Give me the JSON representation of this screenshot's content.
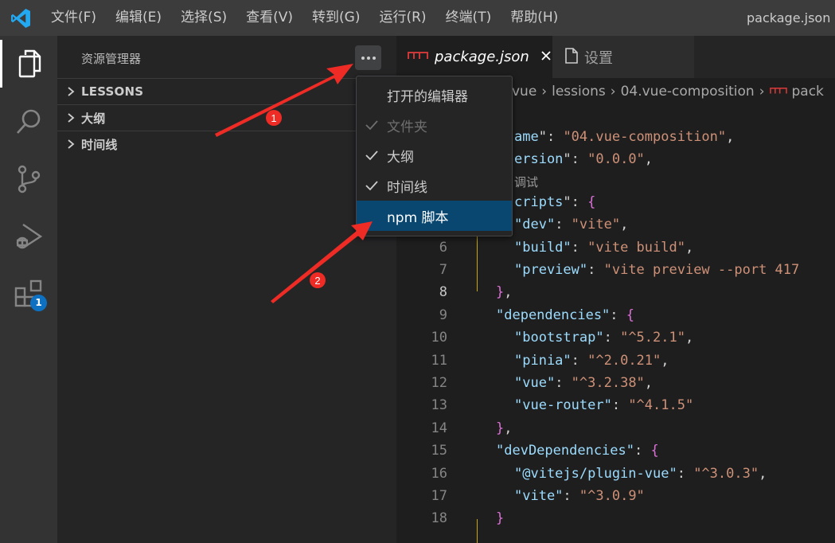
{
  "titlebar": {
    "menu": [
      "文件(F)",
      "编辑(E)",
      "选择(S)",
      "查看(V)",
      "转到(G)",
      "运行(R)",
      "终端(T)",
      "帮助(H)"
    ],
    "window_title": "package.json -"
  },
  "activitybar": {
    "items": [
      "explorer-icon",
      "search-icon",
      "source-control-icon",
      "run-debug-icon",
      "extensions-icon"
    ],
    "extensions_badge": "1"
  },
  "sidebar": {
    "title": "资源管理器",
    "sections": [
      "LESSONS",
      "大纲",
      "时间线"
    ]
  },
  "menu": {
    "items": [
      {
        "label": "打开的编辑器",
        "checked": false,
        "disabled": false,
        "highlighted": false
      },
      {
        "label": "文件夹",
        "checked": true,
        "disabled": true,
        "highlighted": false
      },
      {
        "label": "大纲",
        "checked": true,
        "disabled": false,
        "highlighted": false
      },
      {
        "label": "时间线",
        "checked": true,
        "disabled": false,
        "highlighted": false
      },
      {
        "label": "npm 脚本",
        "checked": false,
        "disabled": false,
        "highlighted": true
      }
    ]
  },
  "tabs": [
    {
      "label": "package.json",
      "icon": "npm-icon",
      "active": true
    },
    {
      "label": "设置",
      "icon": "file-icon",
      "active": false
    }
  ],
  "breadcrumb": [
    "vue",
    "lessions",
    "04.vue-composition",
    "pack"
  ],
  "editor": {
    "codelens": "调试",
    "line_numbers": [
      "6",
      "7",
      "8",
      "9",
      "10",
      "11",
      "12",
      "13",
      "14",
      "15",
      "16",
      "17",
      "18"
    ],
    "current_line": "8",
    "lines": [
      {
        "tokens": [
          {
            "t": "ame",
            "c": "k"
          },
          {
            "t": "\": ",
            "c": "p"
          },
          {
            "t": "\"04.vue-composition\"",
            "c": "s"
          },
          {
            "t": ",",
            "c": "p"
          }
        ]
      },
      {
        "tokens": [
          {
            "t": "ersion",
            "c": "k"
          },
          {
            "t": "\": ",
            "c": "p"
          },
          {
            "t": "\"0.0.0\"",
            "c": "s"
          },
          {
            "t": ",",
            "c": "p"
          }
        ]
      },
      {
        "tokens": [
          {
            "t": "cripts",
            "c": "k"
          },
          {
            "t": "\": ",
            "c": "p"
          },
          {
            "t": "{",
            "c": "b2"
          }
        ]
      },
      {
        "tokens": [
          {
            "t": "\"dev\"",
            "c": "k"
          },
          {
            "t": ": ",
            "c": "p"
          },
          {
            "t": "\"vite\"",
            "c": "s"
          },
          {
            "t": ",",
            "c": "p"
          }
        ]
      },
      {
        "tokens": [
          {
            "t": "\"build\"",
            "c": "k"
          },
          {
            "t": ": ",
            "c": "p"
          },
          {
            "t": "\"vite build\"",
            "c": "s"
          },
          {
            "t": ",",
            "c": "p"
          }
        ]
      },
      {
        "tokens": [
          {
            "t": "\"preview\"",
            "c": "k"
          },
          {
            "t": ": ",
            "c": "p"
          },
          {
            "t": "\"vite preview --port 417",
            "c": "s"
          }
        ]
      },
      {
        "tokens": [
          {
            "t": "}",
            "c": "b2"
          },
          {
            "t": ",",
            "c": "p"
          }
        ]
      },
      {
        "tokens": [
          {
            "t": "\"dependencies\"",
            "c": "k"
          },
          {
            "t": ": ",
            "c": "p"
          },
          {
            "t": "{",
            "c": "b2"
          }
        ]
      },
      {
        "tokens": [
          {
            "t": "\"bootstrap\"",
            "c": "k"
          },
          {
            "t": ": ",
            "c": "p"
          },
          {
            "t": "\"^5.2.1\"",
            "c": "s"
          },
          {
            "t": ",",
            "c": "p"
          }
        ]
      },
      {
        "tokens": [
          {
            "t": "\"pinia\"",
            "c": "k"
          },
          {
            "t": ": ",
            "c": "p"
          },
          {
            "t": "\"^2.0.21\"",
            "c": "s"
          },
          {
            "t": ",",
            "c": "p"
          }
        ]
      },
      {
        "tokens": [
          {
            "t": "\"vue\"",
            "c": "k"
          },
          {
            "t": ": ",
            "c": "p"
          },
          {
            "t": "\"^3.2.38\"",
            "c": "s"
          },
          {
            "t": ",",
            "c": "p"
          }
        ]
      },
      {
        "tokens": [
          {
            "t": "\"vue-router\"",
            "c": "k"
          },
          {
            "t": ": ",
            "c": "p"
          },
          {
            "t": "\"^4.1.5\"",
            "c": "s"
          }
        ]
      },
      {
        "tokens": [
          {
            "t": "}",
            "c": "b2"
          },
          {
            "t": ",",
            "c": "p"
          }
        ]
      },
      {
        "tokens": [
          {
            "t": "\"devDependencies\"",
            "c": "k"
          },
          {
            "t": ": ",
            "c": "p"
          },
          {
            "t": "{",
            "c": "b2"
          }
        ]
      },
      {
        "tokens": [
          {
            "t": "\"@vitejs/plugin-vue\"",
            "c": "k"
          },
          {
            "t": ": ",
            "c": "p"
          },
          {
            "t": "\"^3.0.3\"",
            "c": "s"
          },
          {
            "t": ",",
            "c": "p"
          }
        ]
      },
      {
        "tokens": [
          {
            "t": "\"vite\"",
            "c": "k"
          },
          {
            "t": ": ",
            "c": "p"
          },
          {
            "t": "\"^3.0.9\"",
            "c": "s"
          }
        ]
      },
      {
        "tokens": [
          {
            "t": "}",
            "c": "b2"
          }
        ]
      }
    ]
  },
  "annotations": [
    "1",
    "2"
  ],
  "colors": {
    "accent": "#0e70c0",
    "highlight": "#094771",
    "arrow": "#ee2b24"
  }
}
